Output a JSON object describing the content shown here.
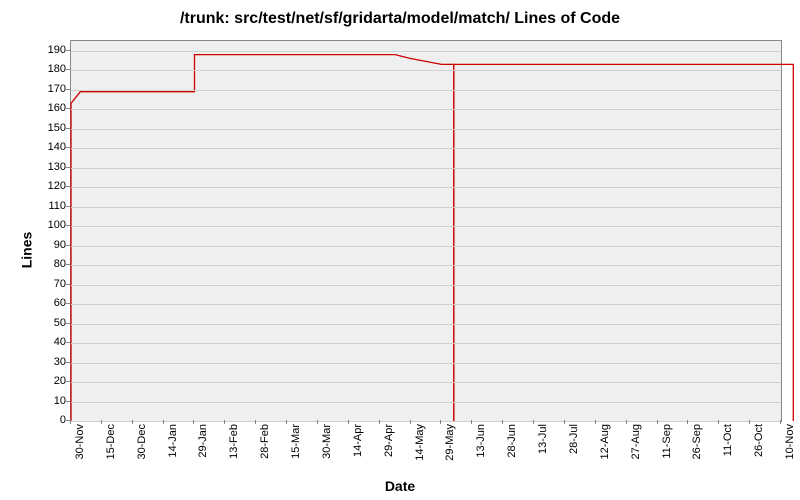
{
  "chart_data": {
    "type": "line",
    "title": "/trunk: src/test/net/sf/gridarta/model/match/ Lines of Code",
    "xlabel": "Date",
    "ylabel": "Lines",
    "ylim": [
      0,
      195
    ],
    "y_ticks": [
      0,
      10,
      20,
      30,
      40,
      50,
      60,
      70,
      80,
      90,
      100,
      110,
      120,
      130,
      140,
      150,
      160,
      170,
      180,
      190
    ],
    "x_categories": [
      "30-Nov",
      "15-Dec",
      "30-Dec",
      "14-Jan",
      "29-Jan",
      "13-Feb",
      "28-Feb",
      "15-Mar",
      "30-Mar",
      "14-Apr",
      "29-Apr",
      "14-May",
      "29-May",
      "13-Jun",
      "28-Jun",
      "13-Jul",
      "28-Jul",
      "12-Aug",
      "27-Aug",
      "11-Sep",
      "26-Sep",
      "11-Oct",
      "26-Oct",
      "10-Nov"
    ],
    "series": [
      {
        "name": "lines-of-code",
        "color": "#cc0000",
        "segments": [
          {
            "points": [
              [
                0.0,
                0
              ],
              [
                0.0,
                163
              ],
              [
                0.3,
                169
              ],
              [
                4.0,
                169
              ],
              [
                4.0,
                188
              ],
              [
                10.5,
                188
              ],
              [
                11.0,
                186
              ],
              [
                12.0,
                183
              ],
              [
                12.4,
                183
              ],
              [
                12.4,
                0
              ]
            ]
          },
          {
            "points": [
              [
                12.4,
                0
              ],
              [
                12.4,
                183
              ],
              [
                23.4,
                183
              ],
              [
                23.4,
                0
              ]
            ]
          }
        ]
      }
    ]
  }
}
